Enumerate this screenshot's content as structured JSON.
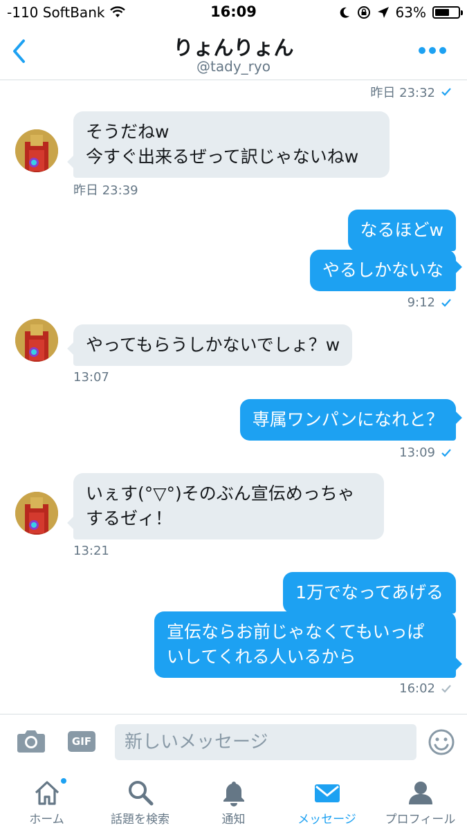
{
  "status_bar": {
    "carrier": "-110 SoftBank",
    "time": "16:09",
    "battery": "63%",
    "battery_level": 0.63,
    "icons": [
      "wifi-icon",
      "moon-icon",
      "rotation-lock-icon",
      "location-icon",
      "battery-icon"
    ]
  },
  "header": {
    "title": "りょんりょん",
    "handle": "@tady_ryo",
    "back_icon": "chevron-left-icon",
    "more_icon": "more-dots-icon"
  },
  "messages": [
    {
      "id": "ts0",
      "type": "timestamp",
      "text": "昨日 23:32",
      "read": true
    },
    {
      "id": "m1",
      "from": "them",
      "text": "そうだねw\n今すぐ出来るぜって訳じゃないねw"
    },
    {
      "id": "ts1",
      "type": "timestamp",
      "text": "昨日 23:39"
    },
    {
      "id": "m2",
      "from": "me",
      "text": "なるほどw"
    },
    {
      "id": "m3",
      "from": "me",
      "text": "やるしかないな"
    },
    {
      "id": "ts2",
      "type": "timestamp",
      "text": "9:12",
      "read": true
    },
    {
      "id": "m4",
      "from": "them",
      "text": "やってもらうしかないでしょ？w"
    },
    {
      "id": "ts3",
      "type": "timestamp",
      "text": "13:07"
    },
    {
      "id": "m5",
      "from": "me",
      "text": "専属ワンパンになれと？"
    },
    {
      "id": "ts4",
      "type": "timestamp",
      "text": "13:09",
      "read": true
    },
    {
      "id": "m6",
      "from": "them",
      "text": "いぇす(°▽°)そのぶん宣伝めっちゃ\nするゼィ！"
    },
    {
      "id": "ts5",
      "type": "timestamp",
      "text": "13:21"
    },
    {
      "id": "m7",
      "from": "me",
      "text": "1万でなってあげる"
    },
    {
      "id": "m8",
      "from": "me",
      "text": "宣伝ならお前じゃなくてもいっぱ\nいしてくれる人いるから"
    },
    {
      "id": "ts6",
      "type": "timestamp",
      "text": "16:02",
      "read": false
    }
  ],
  "composer": {
    "placeholder": "新しいメッセージ",
    "gif_label": "GIF",
    "camera_icon": "camera-icon",
    "emoji_icon": "emoji-icon"
  },
  "tabs": [
    {
      "label": "ホーム",
      "icon": "home-icon",
      "active": false,
      "badge": true
    },
    {
      "label": "話題を検索",
      "icon": "search-icon",
      "active": false
    },
    {
      "label": "通知",
      "icon": "bell-icon",
      "active": false
    },
    {
      "label": "メッセージ",
      "icon": "mail-icon",
      "active": true
    },
    {
      "label": "プロフィール",
      "icon": "profile-icon",
      "active": false
    }
  ],
  "colors": {
    "accent": "#1da1f2",
    "incoming_bubble": "#e6ecf0",
    "meta_text": "#657786"
  }
}
